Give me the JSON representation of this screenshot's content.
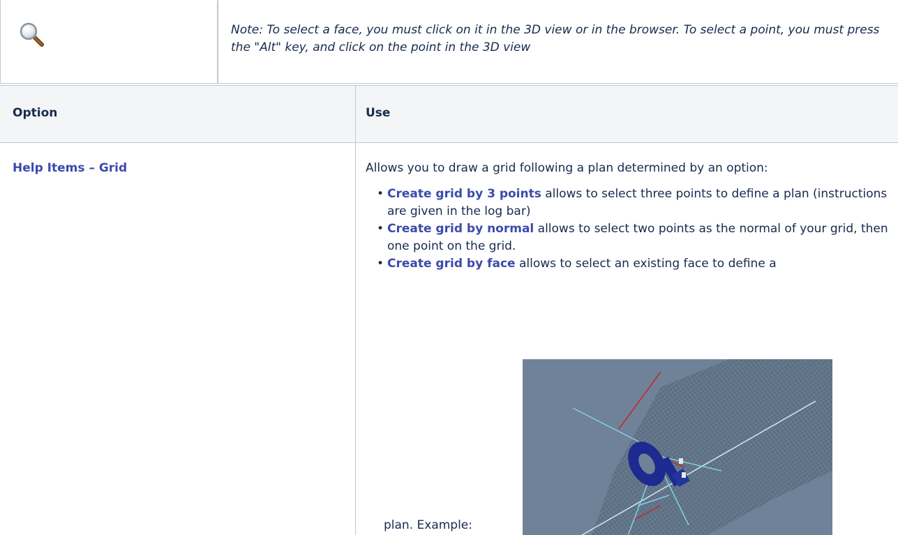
{
  "note": {
    "icon": "magnifier-icon",
    "text": "Note: To select a face, you must click on it in the 3D view or in the browser. To select a point, you must press the \"Alt\" key, and click on the point in the 3D view"
  },
  "table": {
    "headers": {
      "option": "Option",
      "use": "Use"
    },
    "rows": [
      {
        "option": "Help Items – Grid",
        "intro": "Allows you to draw a grid following a plan determined by an option:",
        "items": [
          {
            "link": "Create grid by 3 points",
            "text": " allows to select three points to define a plan (instructions are given in the log bar)"
          },
          {
            "link": "Create grid by normal",
            "text": " allows to select two points as the normal of your grid, then one point on the grid."
          },
          {
            "link": "Create grid by face",
            "text": " allows to select an existing face to define a"
          }
        ],
        "example_label": "plan. Example:"
      }
    ]
  },
  "colors": {
    "link": "#3b4bac",
    "header_bg": "#f4f5f7",
    "border": "#c1c7d0",
    "image_bg": "#6f8298"
  }
}
